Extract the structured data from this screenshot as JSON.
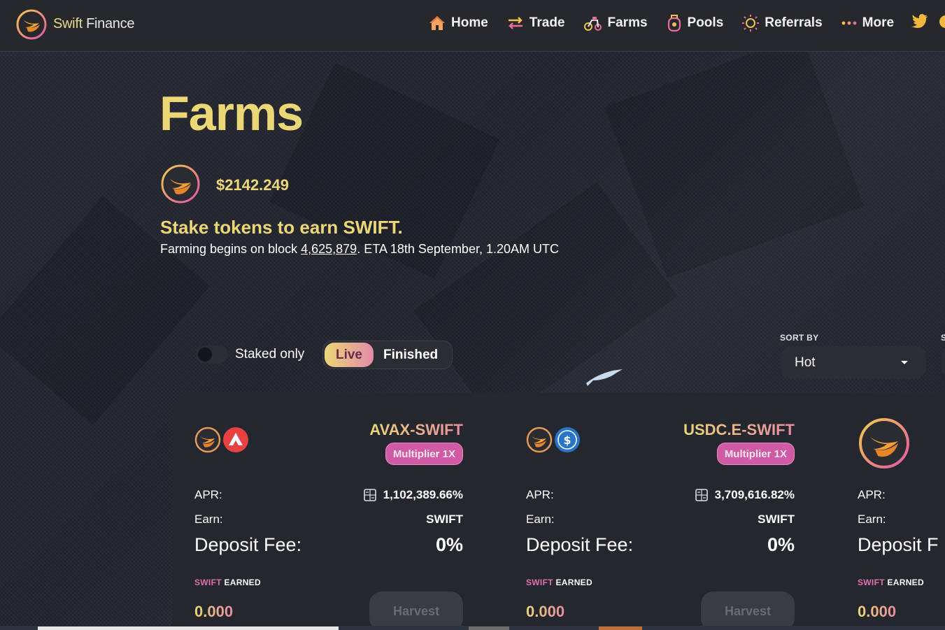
{
  "brand": {
    "name_part1": "Swift",
    "name_part2": " Finance",
    "logo_icon": "swift-logo"
  },
  "nav": [
    {
      "label": "Home",
      "icon": "home-icon"
    },
    {
      "label": "Trade",
      "icon": "trade-icon"
    },
    {
      "label": "Farms",
      "icon": "farms-icon"
    },
    {
      "label": "Pools",
      "icon": "pools-icon"
    },
    {
      "label": "Referrals",
      "icon": "referrals-icon"
    },
    {
      "label": "More",
      "icon": "more-icon"
    }
  ],
  "social": {
    "twitter_icon": "twitter-icon"
  },
  "page": {
    "title": "Farms",
    "price": "$2142.249",
    "subtitle": "Stake tokens to earn SWIFT.",
    "desc_prefix": "Farming begins on block ",
    "desc_block": "4,625,879",
    "desc_suffix": ". ETA 18th September, 1.20AM UTC"
  },
  "controls": {
    "staked_only_label": "Staked only",
    "staked_only_on": false,
    "tab_live": "Live",
    "tab_finished": "Finished",
    "sort_label": "SORT BY",
    "sort_value": "Hot",
    "second_label_fragment": "S"
  },
  "cards": [
    {
      "name": "AVAX-SWIFT",
      "multiplier": "Multiplier 1X",
      "apr_label": "APR:",
      "apr_value": "1,102,389.66%",
      "earn_label": "Earn:",
      "earn_value": "SWIFT",
      "fee_label": "Deposit Fee:",
      "fee_value": "0%",
      "earned_token": "SWIFT",
      "earned_word": "EARNED",
      "earned_value": "0.000",
      "harvest_label": "Harvest",
      "tokens": [
        "swift-token-icon",
        "avax-token-icon"
      ]
    },
    {
      "name": "USDC.E-SWIFT",
      "multiplier": "Multiplier 1X",
      "apr_label": "APR:",
      "apr_value": "3,709,616.82%",
      "earn_label": "Earn:",
      "earn_value": "SWIFT",
      "fee_label": "Deposit Fee:",
      "fee_value": "0%",
      "earned_token": "SWIFT",
      "earned_word": "EARNED",
      "earned_value": "0.000",
      "harvest_label": "Harvest",
      "tokens": [
        "swift-token-icon",
        "usdc-token-icon"
      ]
    },
    {
      "name": "",
      "apr_label": "APR:",
      "earn_label": "Earn:",
      "fee_label": "Deposit F",
      "earned_token": "SWIFT",
      "earned_word": "EARNED",
      "earned_value": "0.000",
      "tokens": [
        "swift-token-icon"
      ]
    }
  ],
  "colors": {
    "accent_gold": "#ecd776",
    "accent_pink": "#d05aa3",
    "header_bg": "#27282c",
    "card_bg": "#25272e",
    "page_bg": "#1f222b"
  }
}
